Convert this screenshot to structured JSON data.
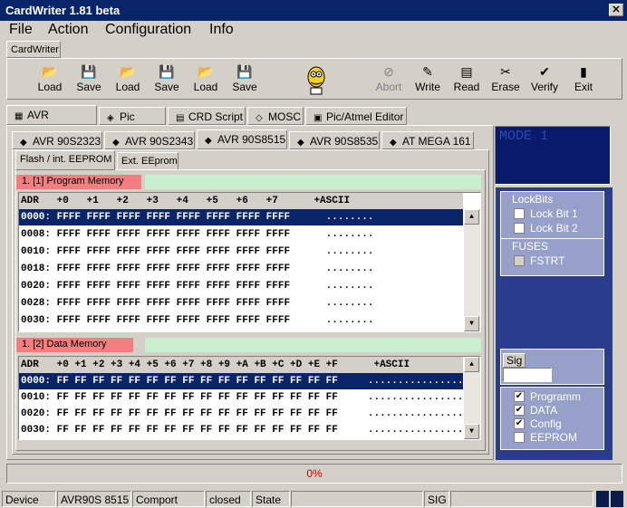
{
  "window": {
    "title": "CardWriter 1.81 beta",
    "close_glyph": "✕"
  },
  "menu": [
    "File",
    "Action",
    "Configuration",
    "Info"
  ],
  "app_tab": "CardWriter",
  "toolbar": [
    {
      "label": "Load",
      "icon": "open-icon",
      "glyph": "📂"
    },
    {
      "label": "Save",
      "icon": "save-icon",
      "glyph": "💾"
    },
    {
      "label": "Load",
      "icon": "open-icon",
      "glyph": "📂"
    },
    {
      "label": "Save",
      "icon": "save-icon",
      "glyph": "💾"
    },
    {
      "label": "Load",
      "icon": "open-icon",
      "glyph": "📂"
    },
    {
      "label": "Save",
      "icon": "save-icon",
      "glyph": "💾"
    },
    {
      "label": "Abort",
      "icon": "abort-icon",
      "glyph": "⊘",
      "disabled": true
    },
    {
      "label": "Write",
      "icon": "write-icon",
      "glyph": "✎"
    },
    {
      "label": "Read",
      "icon": "read-icon",
      "glyph": "▤"
    },
    {
      "label": "Erase",
      "icon": "erase-icon",
      "glyph": "✂"
    },
    {
      "label": "Verify",
      "icon": "verify-icon",
      "glyph": "✔"
    },
    {
      "label": "Exit",
      "icon": "exit-icon",
      "glyph": "▮"
    }
  ],
  "main_tabs": [
    "AVR",
    "Pic",
    "CRD Script",
    "MOSC",
    "Pic/Atmel Editor"
  ],
  "device_tabs": [
    "AVR 90S2323",
    "AVR 90S2343",
    "AVR 90S8515",
    "AVR 90S8535",
    "AT MEGA 161"
  ],
  "mem_tabs": [
    "Flash / int. EEPROM",
    "Ext. EEprom"
  ],
  "program_memory": {
    "title": "1. [1] Program Memory",
    "header": "ADR   +0   +1   +2   +3   +4   +5   +6   +7      +ASCII",
    "rows": [
      "0000: FFFF FFFF FFFF FFFF FFFF FFFF FFFF FFFF      ........",
      "0008: FFFF FFFF FFFF FFFF FFFF FFFF FFFF FFFF      ........",
      "0010: FFFF FFFF FFFF FFFF FFFF FFFF FFFF FFFF      ........",
      "0018: FFFF FFFF FFFF FFFF FFFF FFFF FFFF FFFF      ........",
      "0020: FFFF FFFF FFFF FFFF FFFF FFFF FFFF FFFF      ........",
      "0028: FFFF FFFF FFFF FFFF FFFF FFFF FFFF FFFF      ........",
      "0030: FFFF FFFF FFFF FFFF FFFF FFFF FFFF FFFF      ........"
    ]
  },
  "data_memory": {
    "title": "1. [2] Data Memory",
    "header": "ADR   +0 +1 +2 +3 +4 +5 +6 +7 +8 +9 +A +B +C +D +E +F      +ASCII",
    "rows": [
      "0000: FF FF FF FF FF FF FF FF FF FF FF FF FF FF FF FF     ................",
      "0010: FF FF FF FF FF FF FF FF FF FF FF FF FF FF FF FF     ................",
      "0020: FF FF FF FF FF FF FF FF FF FF FF FF FF FF FF FF     ................",
      "0030: FF FF FF FF FF FF FF FF FF FF FF FF FF FF FF FF     ................"
    ]
  },
  "mode_display": "MODE 1",
  "lockbits": {
    "title": "LockBits",
    "items": [
      "Lock Bit 1",
      "Lock Bit 2"
    ]
  },
  "fuses": {
    "title": "FUSES",
    "items": [
      "FSTRT"
    ]
  },
  "sig": {
    "label": "Sig",
    "value": ""
  },
  "options": [
    {
      "label": "Programm",
      "checked": true
    },
    {
      "label": "DATA",
      "checked": true
    },
    {
      "label": "Config",
      "checked": true
    },
    {
      "label": "EEPROM",
      "checked": false
    }
  ],
  "progress": {
    "text": "0%",
    "value": 0
  },
  "status": {
    "device_label": "Device",
    "device_value": "AVR90S 8515",
    "comport_label": "Comport",
    "comport_value": "closed",
    "state_label": "State",
    "sig_label": "SIG"
  }
}
